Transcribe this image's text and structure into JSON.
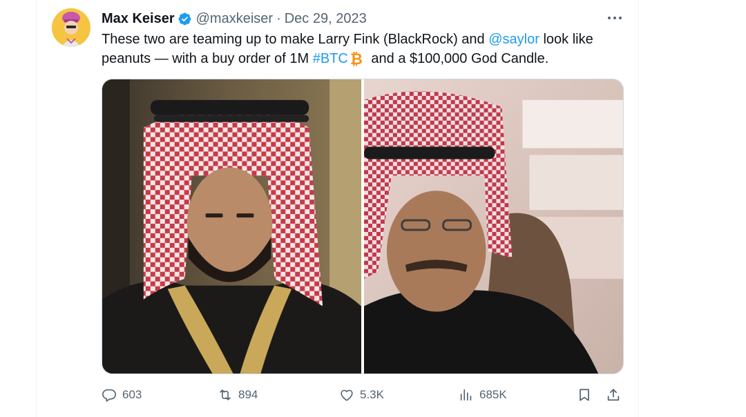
{
  "tweet": {
    "author_name": "Max Keiser",
    "handle": "@maxkeiser",
    "separator": "·",
    "date": "Dec 29, 2023",
    "text_part1": "These two are teaming up to make Larry Fink (BlackRock) and ",
    "mention": "@saylor",
    "text_part2": " look like peanuts —  with a buy order of 1M ",
    "hashtag": "#BTC",
    "btc_symbol": "₿",
    "text_part3": " and a $100,000 God Candle."
  },
  "icons": {
    "verified": "verified-badge-icon",
    "more": "more-options-icon",
    "reply": "reply-icon",
    "retweet": "retweet-icon",
    "like": "like-icon",
    "views": "views-icon",
    "bookmark": "bookmark-icon",
    "share": "share-icon"
  },
  "stats": {
    "replies": "603",
    "retweets": "894",
    "likes": "5.3K",
    "views": "685K"
  },
  "colors": {
    "link": "#1d9bf0",
    "verified": "#1d9bf0",
    "secondary_text": "#536471",
    "bitcoin": "#f7931a"
  }
}
